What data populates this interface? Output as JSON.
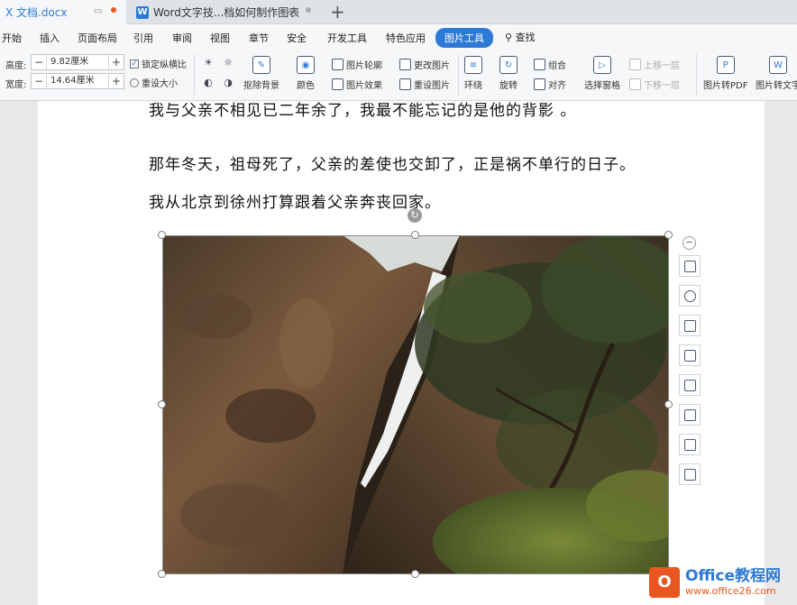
{
  "tabs": [
    {
      "title": "X 文档.docx",
      "icon": "wps-writer-icon",
      "active": true
    },
    {
      "title": "Word文字技...档如何制作图表",
      "icon": "wps-writer-icon",
      "active": false
    }
  ],
  "menu": {
    "items": [
      "开始",
      "插入",
      "页面布局",
      "引用",
      "审阅",
      "视图",
      "章节",
      "安全",
      "开发工具",
      "特色应用"
    ],
    "active": "图片工具",
    "search": "查找"
  },
  "ribbon": {
    "height_label": "高度:",
    "height_value": "9.82厘米",
    "width_label": "宽度:",
    "width_value": "14.64厘米",
    "lock_ratio": "锁定纵横比",
    "reset_size": "重设大小",
    "remove_bg": "抠除背景",
    "color": "颜色",
    "pic_outline": "图片轮廓",
    "pic_effect": "图片效果",
    "change_pic": "更改图片",
    "reset_pic": "重设图片",
    "wrap": "环绕",
    "rotate": "旋转",
    "group": "组合",
    "align": "对齐",
    "select_pane": "选择窗格",
    "bring_forward": "上移一层",
    "send_backward": "下移一层",
    "to_pdf": "图片转PDF",
    "to_text": "图片转文字"
  },
  "document": {
    "line1": "我与父亲不相见已二年余了，我最不能忘记的是他的背影 。",
    "line2": "那年冬天，祖母死了，父亲的差使也交卸了，正是祸不单行的日子。",
    "line3": "我从北京到徐州打算跟着父亲奔丧回家。"
  },
  "side_tools": [
    "layout-options-icon",
    "zoom-icon",
    "remove-bg-icon",
    "crop-icon",
    "enhance-icon",
    "convert-icon",
    "pic-to-text-icon",
    "print-icon"
  ],
  "watermark": {
    "brand": "Office教程网",
    "url": "www.office26.com"
  }
}
